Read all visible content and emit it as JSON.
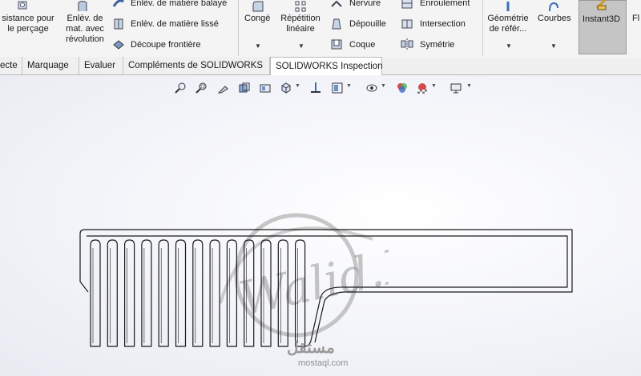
{
  "ribbon": {
    "col1": {
      "line1": "sistance pour",
      "line2": "le perçage"
    },
    "revolve_cut": {
      "line1": "Enlèv. de",
      "line2": "mat. avec",
      "line3": "révolution"
    },
    "sweep_cut": "Enlèv. de matière balayé",
    "loft_cut": "Enlèv. de matière lissé",
    "boundary_cut": "Découpe frontière",
    "fillet": "Congé",
    "linear_pattern": {
      "line1": "Répétition",
      "line2": "linéaire"
    },
    "rib": "Nervure",
    "draft": "Dépouille",
    "shell": "Coque",
    "wrap": "Enroulement",
    "intersect": "Intersection",
    "mirror": "Symétrie",
    "ref_geometry": {
      "line1": "Géométrie",
      "line2": "de référ..."
    },
    "curves": "Courbes",
    "instant3d": "Instant3D",
    "cut_next": "Fl"
  },
  "tabs": [
    {
      "label": "ecte"
    },
    {
      "label": "Marquage"
    },
    {
      "label": "Evaluer"
    },
    {
      "label": "Compléments de SOLIDWORKS"
    },
    {
      "label": "SOLIDWORKS Inspection"
    }
  ],
  "watermark": {
    "signature": "Walid.D",
    "brand_arabic": "مستقل",
    "brand_latin": "mostaql.com"
  },
  "colors": {
    "ribbon_bg": "#f4f4f4",
    "tab_bg": "#f0f0f0",
    "model_line": "#1a1a1a",
    "watermark": "#9a9a9a"
  }
}
